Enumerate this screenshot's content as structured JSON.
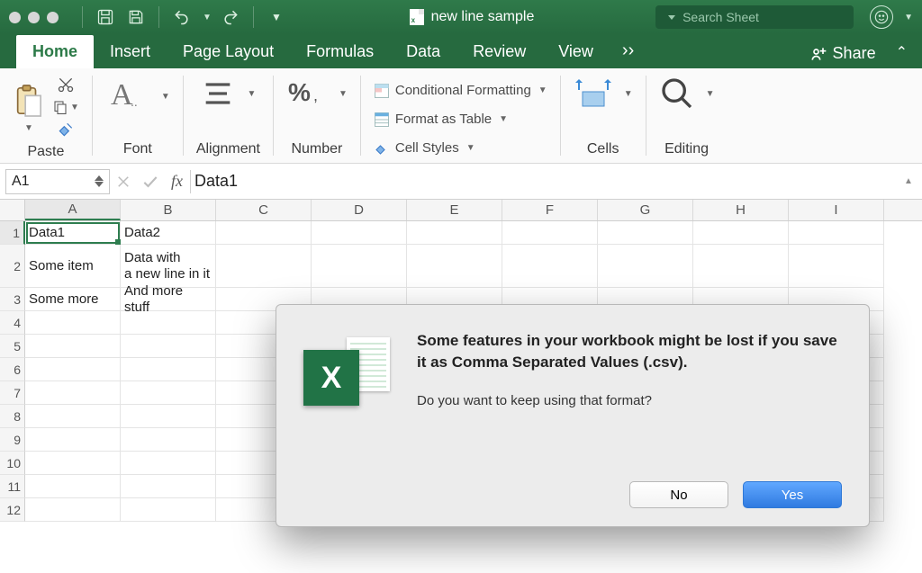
{
  "titlebar": {
    "filename": "new line sample",
    "search_placeholder": "Search Sheet"
  },
  "tabs": {
    "items": [
      "Home",
      "Insert",
      "Page Layout",
      "Formulas",
      "Data",
      "Review",
      "View"
    ],
    "active": "Home",
    "share_label": "Share"
  },
  "ribbon": {
    "paste_label": "Paste",
    "font_label": "Font",
    "alignment_label": "Alignment",
    "number_label": "Number",
    "cond_fmt": "Conditional Formatting",
    "fmt_table": "Format as Table",
    "cell_styles": "Cell Styles",
    "cells_label": "Cells",
    "editing_label": "Editing"
  },
  "formula_bar": {
    "cell_ref": "A1",
    "formula": "Data1"
  },
  "sheet": {
    "columns": [
      "A",
      "B",
      "C",
      "D",
      "E",
      "F",
      "G",
      "H",
      "I"
    ],
    "rows": [
      {
        "num": 1,
        "cells": [
          "Data1",
          "Data2",
          "",
          "",
          "",
          "",
          "",
          "",
          ""
        ]
      },
      {
        "num": 2,
        "tall": true,
        "cells": [
          "Some item",
          "Data with\na new line in it",
          "",
          "",
          "",
          "",
          "",
          "",
          ""
        ]
      },
      {
        "num": 3,
        "cells": [
          "Some more",
          "And more stuff",
          "",
          "",
          "",
          "",
          "",
          "",
          ""
        ]
      },
      {
        "num": 4,
        "cells": [
          "",
          "",
          "",
          "",
          "",
          "",
          "",
          "",
          ""
        ]
      },
      {
        "num": 5,
        "cells": [
          "",
          "",
          "",
          "",
          "",
          "",
          "",
          "",
          ""
        ]
      },
      {
        "num": 6,
        "cells": [
          "",
          "",
          "",
          "",
          "",
          "",
          "",
          "",
          ""
        ]
      },
      {
        "num": 7,
        "cells": [
          "",
          "",
          "",
          "",
          "",
          "",
          "",
          "",
          ""
        ]
      },
      {
        "num": 8,
        "cells": [
          "",
          "",
          "",
          "",
          "",
          "",
          "",
          "",
          ""
        ]
      },
      {
        "num": 9,
        "cells": [
          "",
          "",
          "",
          "",
          "",
          "",
          "",
          "",
          ""
        ]
      },
      {
        "num": 10,
        "cells": [
          "",
          "",
          "",
          "",
          "",
          "",
          "",
          "",
          ""
        ]
      },
      {
        "num": 11,
        "cells": [
          "",
          "",
          "",
          "",
          "",
          "",
          "",
          "",
          ""
        ]
      },
      {
        "num": 12,
        "cells": [
          "",
          "",
          "",
          "",
          "",
          "",
          "",
          "",
          ""
        ]
      }
    ],
    "active_cell": "A1"
  },
  "dialog": {
    "headline": "Some features in your workbook might be lost if you save it as Comma Separated Values (.csv).",
    "subtext": "Do you want to keep using that format?",
    "no_label": "No",
    "yes_label": "Yes"
  }
}
